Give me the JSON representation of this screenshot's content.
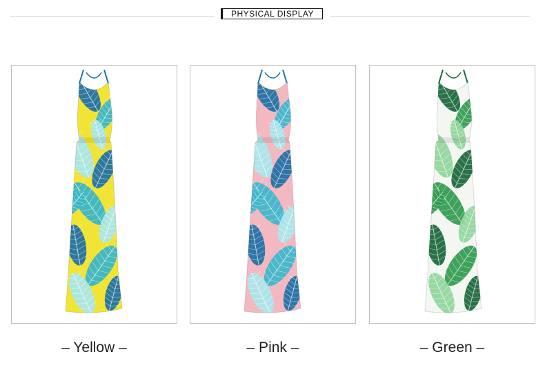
{
  "header": {
    "title": "PHYSICAL DISPLAY"
  },
  "products": [
    {
      "caption": "– Yellow –",
      "base_color": "#f2e437",
      "leaf_color": "#37b5c9",
      "leaf_dark": "#1d6fa6",
      "leaf_light": "#a8e6ec"
    },
    {
      "caption": "– Pink –",
      "base_color": "#f4b8c0",
      "leaf_color": "#3db6cc",
      "leaf_dark": "#1d6fa6",
      "leaf_light": "#a8e6ec"
    },
    {
      "caption": "– Green –",
      "base_color": "#f4f6f2",
      "leaf_color": "#2e9a4e",
      "leaf_dark": "#17663a",
      "leaf_light": "#8fd59b"
    }
  ]
}
